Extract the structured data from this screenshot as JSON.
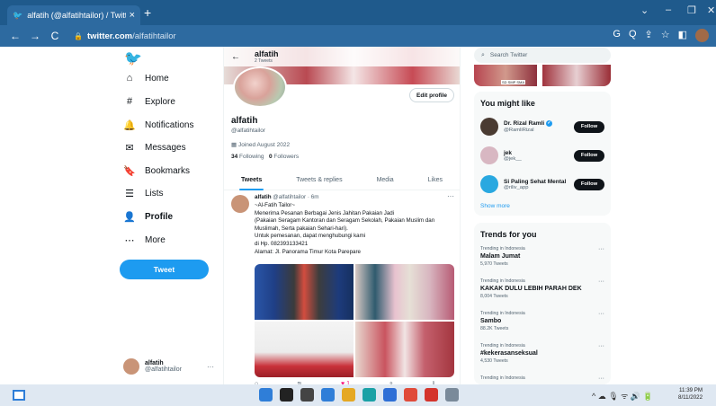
{
  "browser": {
    "tab_title": "alfatih (@alfatihtailor) / Twitter",
    "tab_close": "×",
    "new_tab": "+",
    "url_domain": "twitter.com",
    "url_path": "/alfatihtailor",
    "nav": {
      "back": "←",
      "forward": "→",
      "reload": "C"
    },
    "window_controls": {
      "chevron": "⌄",
      "minimize": "–",
      "maximize": "❐",
      "close": "✕"
    },
    "toolbar_icons": [
      "G",
      "Q",
      "⇪",
      "☆",
      "◧"
    ]
  },
  "sidebar": {
    "logo": "🐦",
    "items": [
      {
        "icon": "⌂",
        "icon_name": "home-icon",
        "label": "Home"
      },
      {
        "icon": "#",
        "icon_name": "explore-icon",
        "label": "Explore"
      },
      {
        "icon": "🔔",
        "icon_name": "bell-icon",
        "label": "Notifications"
      },
      {
        "icon": "✉",
        "icon_name": "mail-icon",
        "label": "Messages"
      },
      {
        "icon": "🔖",
        "icon_name": "bookmark-icon",
        "label": "Bookmarks"
      },
      {
        "icon": "☰",
        "icon_name": "list-icon",
        "label": "Lists"
      },
      {
        "icon": "👤",
        "icon_name": "profile-icon",
        "label": "Profile"
      },
      {
        "icon": "⋯",
        "icon_name": "more-icon",
        "label": "More"
      }
    ],
    "tweet_button": "Tweet",
    "account": {
      "name": "alfatih",
      "handle": "@alfatihtailor",
      "more": "···"
    }
  },
  "profile": {
    "back": "←",
    "name": "alfatih",
    "tweet_count": "2 Tweets",
    "edit_button": "Edit profile",
    "handle": "@alfatihtailor",
    "joined": "Joined August 2022",
    "following_count": "34",
    "following_label": "Following",
    "followers_count": "0",
    "followers_label": "Followers",
    "tabs": [
      "Tweets",
      "Tweets & replies",
      "Media",
      "Likes"
    ]
  },
  "tweet": {
    "name": "alfatih",
    "handle": "@alfatihtailor",
    "time": "· 6m",
    "more": "···",
    "lines": [
      "~Al-Fatih Tailor~",
      "Menerima Pesanan Berbagai Jenis Jahitan Pakaian Jadi",
      "(Pakaian Seragam Kantoran dan Seragam Sekolah, Pakaian Muslim dan",
      "Muslimah, Serta pakaian Sehari-hari).",
      "Untuk pemesanan, dapat menghubungi kami",
      "di Hp. 082393133421",
      "Alamat: Jl. Panorama Timur Kota Parepare"
    ],
    "actions": {
      "reply": "○",
      "retweet": "⇅",
      "like": "♥ 1",
      "share": "⇧",
      "stats": "⫾"
    }
  },
  "right": {
    "search_placeholder": "Search Twitter",
    "media_label": "SD SMP SMA",
    "you_might_like": "You might like",
    "suggestions": [
      {
        "name": "Dr. Rizal Ramli",
        "handle": "@RamliRizal",
        "verified": true,
        "follow": "Follow",
        "color": "#4a3b32"
      },
      {
        "name": "jek",
        "handle": "@jek__",
        "verified": false,
        "follow": "Follow",
        "color": "#d8b7c2"
      },
      {
        "name": "Si Paling Sehat Mental",
        "handle": "@riliv_app",
        "verified": false,
        "follow": "Follow",
        "color": "#29a8e0"
      }
    ],
    "show_more": "Show more",
    "trends_title": "Trends for you",
    "trends": [
      {
        "context": "Trending in Indonesia",
        "name": "Malam Jumat",
        "tweets": "5,970 Tweets"
      },
      {
        "context": "Trending in Indonesia",
        "name": "KAKAK DULU LEBIH PARAH DEK",
        "tweets": "8,004 Tweets"
      },
      {
        "context": "Trending in Indonesia",
        "name": "Sambo",
        "tweets": "88.2K Tweets"
      },
      {
        "context": "Trending in Indonesia",
        "name": "#kekerasanseksual",
        "tweets": "4,530 Tweets"
      },
      {
        "context": "Trending in Indonesia",
        "name": "",
        "tweets": ""
      }
    ],
    "trend_more": "···"
  },
  "taskbar": {
    "time": "11:39 PM",
    "date": "8/11/2022",
    "tray": "^ ☁ 🎙 ᯤ 🔊 🔋",
    "app_colors": [
      "#2f7ed8",
      "#222222",
      "#444444",
      "#2f7ed8",
      "#e5a823",
      "#1aa1a6",
      "#2e6fd6",
      "#e04b3a",
      "#d4342c",
      "#7a8a9a"
    ]
  }
}
